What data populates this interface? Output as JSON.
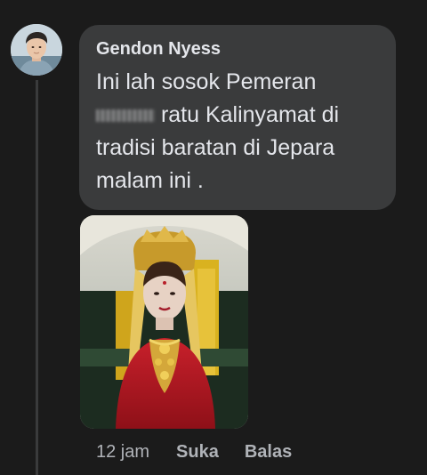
{
  "comment": {
    "author": "Gendon Nyess",
    "text_line_1": "Ini lah sosok Pemeran",
    "text_line_2_after_redaction": " ratu Kalinyamat di",
    "text_line_3": "tradisi baratan di Jepara",
    "text_line_4": "malam ini .",
    "time": "12 jam",
    "like_label": "Suka",
    "reply_label": "Balas"
  },
  "colors": {
    "background": "#1b1b1b",
    "bubble": "#3a3b3c",
    "text_primary": "#e4e6eb",
    "text_secondary": "#b0b3b8"
  },
  "icons": {
    "avatar": "profile-photo-man",
    "attachment": "photo-woman-traditional-costume"
  }
}
